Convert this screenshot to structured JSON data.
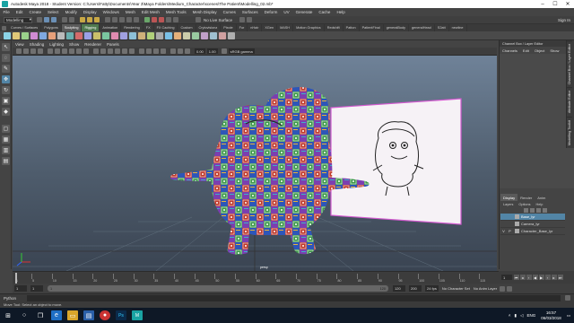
{
  "window": {
    "title": "Autodesk Maya 2018 - Student Version: C:\\Users\\Fatty\\Documents\\Year 3\\Maya Folders\\Medium_Character\\scenes\\The Patient\\Modelling_02.mb*"
  },
  "menus": [
    "File",
    "Edit",
    "Create",
    "Select",
    "Modify",
    "Display",
    "Windows",
    "Mesh",
    "Edit Mesh",
    "Mesh Tools",
    "Mesh Display",
    "Curves",
    "Surfaces",
    "Deform",
    "UV",
    "Generate",
    "Cache",
    "Help"
  ],
  "statusline": {
    "mode": "Modelling",
    "live_surface": "No Live Surface",
    "signin": "Sign In"
  },
  "shelf_tabs": [
    "Curves / Surfaces",
    "Polygons",
    "Sculpting",
    "Rigging",
    "Animation",
    "Rendering",
    "FX",
    "FX Caching",
    "Custom",
    "Crytovisionz",
    "Pixole",
    "Fur",
    "nHair",
    "XGen",
    "MASH",
    "Motion Graphics",
    "Redshift",
    "Patton"
  ],
  "shelf_tabs_right": [
    "PatientFinal",
    "generalBody",
    "generalHead",
    "S2att",
    "newline"
  ],
  "viewport": {
    "menus": [
      "View",
      "Shading",
      "Lighting",
      "Show",
      "Renderer",
      "Panels"
    ],
    "camera_label": "persp",
    "near_field": "0.00",
    "far_field": "1.00",
    "colorspace": "sRGB gamma"
  },
  "channel_box": {
    "header": "Channel Box / Layer Editor",
    "menus": [
      "Channels",
      "Edit",
      "Object",
      "Show"
    ],
    "side_tabs": [
      "Channel Box / Layer Editor",
      "Attribute Editor",
      "Modelling Toolkit"
    ]
  },
  "layer_editor": {
    "tabs": [
      "Display",
      "Render",
      "Anim"
    ],
    "menus": [
      "Layers",
      "Options",
      "Help"
    ],
    "layers": [
      {
        "v": "",
        "p": "",
        "name": "Base_lyr",
        "active": true
      },
      {
        "v": "",
        "p": "",
        "name": "Camera_lyr",
        "active": false
      },
      {
        "v": "V",
        "p": "P",
        "name": "Character_Base_lyr",
        "active": false
      }
    ]
  },
  "timeline": {
    "ticks": [
      "1",
      "5",
      "10",
      "15",
      "20",
      "25",
      "30",
      "35",
      "40",
      "45",
      "50",
      "55",
      "60",
      "65",
      "70",
      "75",
      "80",
      "85",
      "90",
      "95",
      "100",
      "105",
      "110",
      "115",
      "120"
    ],
    "current_frame": "1"
  },
  "range": {
    "start": "1",
    "inner_start": "1",
    "bar_start": "1",
    "bar_end": "120",
    "inner_end": "120",
    "end": "200",
    "fps": "24 fps",
    "character_set": "No Character Set",
    "anim_layer": "No Anim Layer"
  },
  "cmdline": {
    "language": "Python"
  },
  "helpline": "Move Tool: Select an object to move.",
  "taskbar": {
    "time": "16:57",
    "date": "06/03/2018",
    "lang": "ENG"
  }
}
